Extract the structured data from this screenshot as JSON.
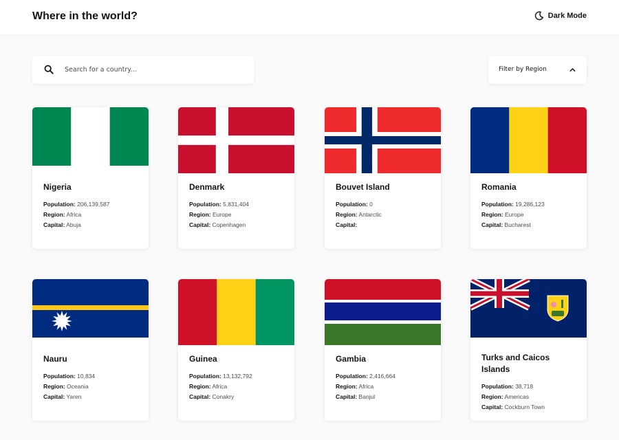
{
  "header": {
    "title": "Where in the world?",
    "theme_toggle_label": "Dark Mode"
  },
  "search": {
    "placeholder": "Search for a country...",
    "value": ""
  },
  "filter": {
    "label": "Filter by Region"
  },
  "labels": {
    "population": "Population:",
    "region": "Region:",
    "capital": "Capital:"
  },
  "countries": [
    {
      "name": "Nigeria",
      "population": "206,139,587",
      "region": "Africa",
      "capital": "Abuja",
      "flag_icon": "nigeria-flag-icon"
    },
    {
      "name": "Denmark",
      "population": "5,831,404",
      "region": "Europe",
      "capital": "Copenhagen",
      "flag_icon": "denmark-flag-icon"
    },
    {
      "name": "Bouvet Island",
      "population": "0",
      "region": "Antarctic",
      "capital": "",
      "flag_icon": "bouvet-island-flag-icon"
    },
    {
      "name": "Romania",
      "population": "19,286,123",
      "region": "Europe",
      "capital": "Bucharest",
      "flag_icon": "romania-flag-icon"
    },
    {
      "name": "Nauru",
      "population": "10,834",
      "region": "Oceania",
      "capital": "Yaren",
      "flag_icon": "nauru-flag-icon"
    },
    {
      "name": "Guinea",
      "population": "13,132,792",
      "region": "Africa",
      "capital": "Conakry",
      "flag_icon": "guinea-flag-icon"
    },
    {
      "name": "Gambia",
      "population": "2,416,664",
      "region": "Africa",
      "capital": "Banjul",
      "flag_icon": "gambia-flag-icon"
    },
    {
      "name": "Turks and Caicos Islands",
      "population": "38,718",
      "region": "Americas",
      "capital": "Cockburn Town",
      "flag_icon": "turks-and-caicos-flag-icon"
    }
  ],
  "colors": {
    "background": "#fafafa",
    "card": "#ffffff",
    "text": "#111517",
    "muted_text": "#4b4b4b"
  }
}
